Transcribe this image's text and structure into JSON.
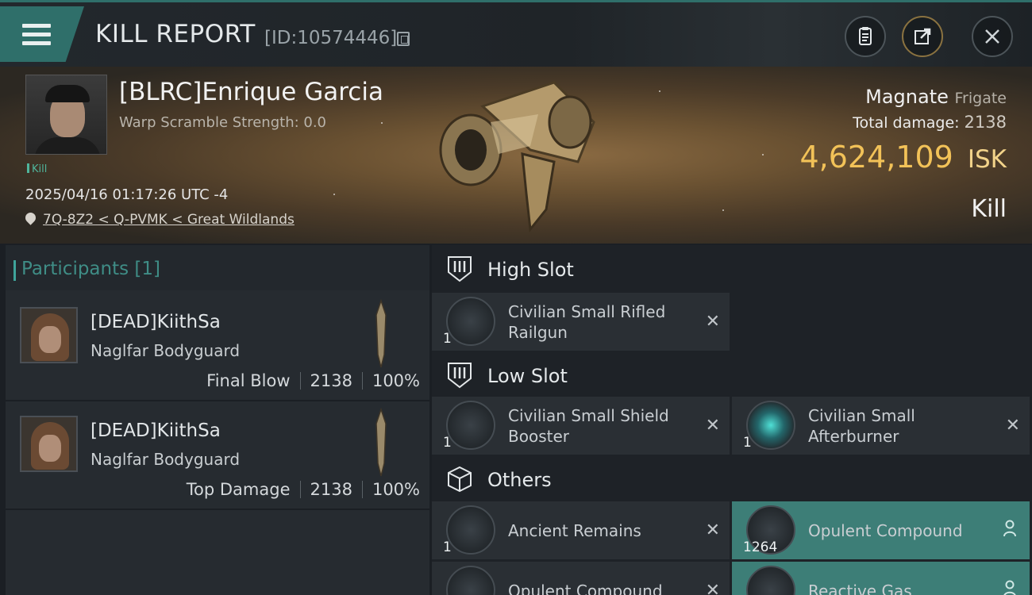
{
  "header": {
    "title": "KILL REPORT",
    "report_id": "[ID:10574446]",
    "icons": [
      "menu-icon",
      "copy-icon",
      "clipboard-icon",
      "share-icon",
      "close-icon"
    ]
  },
  "victim": {
    "name": "[BLRC]Enrique Garcia",
    "warp_scramble": "Warp Scramble Strength: 0.0",
    "tag": "Kill",
    "datetime": "2025/04/16 01:17:26 UTC -4",
    "location": "7Q-8Z2 < Q-PVMK < Great Wildlands",
    "ship_name": "Magnate",
    "ship_class": "Frigate",
    "total_damage_label": "Total damage:",
    "total_damage": "2138",
    "isk_value": "4,624,109",
    "isk_unit": "ISK",
    "result": "Kill"
  },
  "participants": {
    "title": "Participants [1]",
    "rows": [
      {
        "name": "[DEAD]KiithSa",
        "ship": "Naglfar Bodyguard",
        "role": "Final Blow",
        "damage": "2138",
        "percent": "100%"
      },
      {
        "name": "[DEAD]KiithSa",
        "ship": "Naglfar Bodyguard",
        "role": "Top Damage",
        "damage": "2138",
        "percent": "100%"
      }
    ]
  },
  "modules": {
    "high_slot": {
      "label": "High Slot",
      "items": [
        {
          "name": "Civilian Small Rifled Railgun",
          "qty": "1"
        }
      ]
    },
    "low_slot": {
      "label": "Low Slot",
      "items": [
        {
          "name": "Civilian Small Shield Booster",
          "qty": "1"
        },
        {
          "name": "Civilian Small Afterburner",
          "qty": "1"
        }
      ]
    },
    "others": {
      "label": "Others",
      "items": [
        {
          "name": "Ancient Remains",
          "qty": "1"
        },
        {
          "name": "Opulent Compound",
          "qty": "1264"
        },
        {
          "name": "Opulent Compound",
          "qty": ""
        },
        {
          "name": "Reactive Gas",
          "qty": ""
        }
      ]
    }
  },
  "colors": {
    "accent_teal": "#2f6f6a",
    "isk_gold": "#f2c258",
    "highlight_row": "#3d7e77"
  }
}
